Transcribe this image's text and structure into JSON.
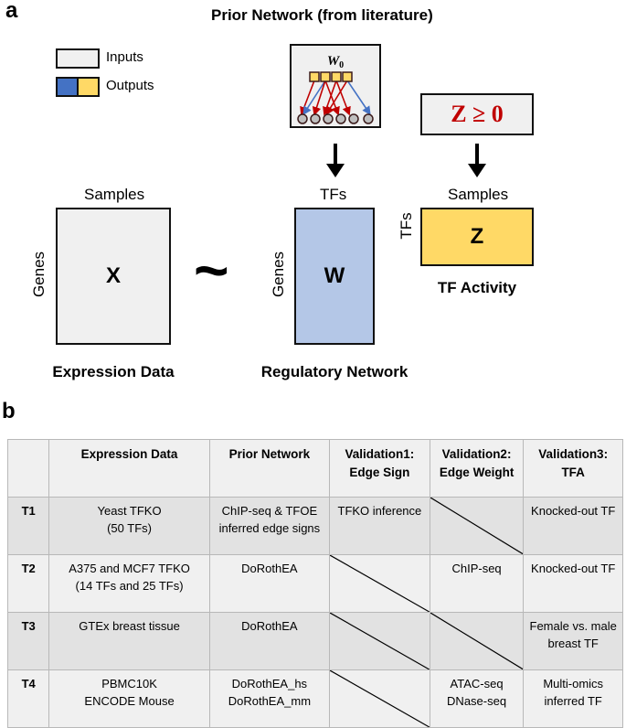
{
  "panel_a": {
    "label": "a",
    "title": "Prior Network (from literature)",
    "legend": [
      {
        "label": "Inputs",
        "colors": [
          "#f0f0f0"
        ]
      },
      {
        "label": "Outputs",
        "colors": [
          "#4472c4",
          "#ffd966"
        ]
      }
    ],
    "prior_box": {
      "label": "W",
      "subscript": "0"
    },
    "constraint_box": {
      "label": "Z ≥ 0",
      "color": "#c00000"
    },
    "matrices": {
      "x": {
        "label": "X",
        "top_axis": "Samples",
        "side_axis": "Genes",
        "caption": "Expression Data",
        "color": "#f0f0f0"
      },
      "w": {
        "label": "W",
        "top_axis": "TFs",
        "side_axis": "Genes",
        "caption": "Regulatory Network",
        "color": "#b4c7e7"
      },
      "z": {
        "label": "Z",
        "top_axis": "Samples",
        "side_axis": "TFs",
        "caption": "TF Activity",
        "color": "#ffd966"
      }
    },
    "approx_symbol": "~",
    "edge_colors": {
      "positive": "#c00000",
      "negative": "#4472c4"
    }
  },
  "panel_b": {
    "label": "b",
    "headers": [
      "",
      "Expression Data",
      "Prior Network",
      "Validation1: Edge Sign",
      "Validation2: Edge Weight",
      "Validation3: TFA"
    ],
    "header_lines": [
      [
        ""
      ],
      [
        "Expression Data"
      ],
      [
        "Prior Network"
      ],
      [
        "Validation1:",
        "Edge Sign"
      ],
      [
        "Validation2:",
        "Edge Weight"
      ],
      [
        "Validation3:",
        "TFA"
      ]
    ],
    "rows": [
      {
        "id": "T1",
        "expression": [
          "Yeast TFKO",
          "(50 TFs)"
        ],
        "prior": [
          "ChIP-seq & TFOE",
          "inferred edge signs"
        ],
        "v1": [
          "TFKO inference"
        ],
        "v2": null,
        "v3": [
          "Knocked-out  TF"
        ]
      },
      {
        "id": "T2",
        "expression": [
          "A375 and MCF7 TFKO",
          "(14 TFs and 25 TFs)"
        ],
        "prior": [
          "DoRothEA"
        ],
        "v1": null,
        "v2": [
          "ChIP-seq"
        ],
        "v3": [
          "Knocked-out  TF"
        ]
      },
      {
        "id": "T3",
        "expression": [
          "GTEx breast tissue"
        ],
        "prior": [
          "DoRothEA"
        ],
        "v1": null,
        "v2": null,
        "v3": [
          "Female vs. male",
          "breast TF"
        ]
      },
      {
        "id": "T4",
        "expression": [
          "PBMC10K",
          "ENCODE Mouse"
        ],
        "prior": [
          "DoRothEA_hs",
          "DoRothEA_mm"
        ],
        "v1": null,
        "v2": [
          "ATAC-seq",
          "DNase-seq"
        ],
        "v3": [
          "Multi-omics",
          "inferred TF"
        ]
      }
    ]
  }
}
